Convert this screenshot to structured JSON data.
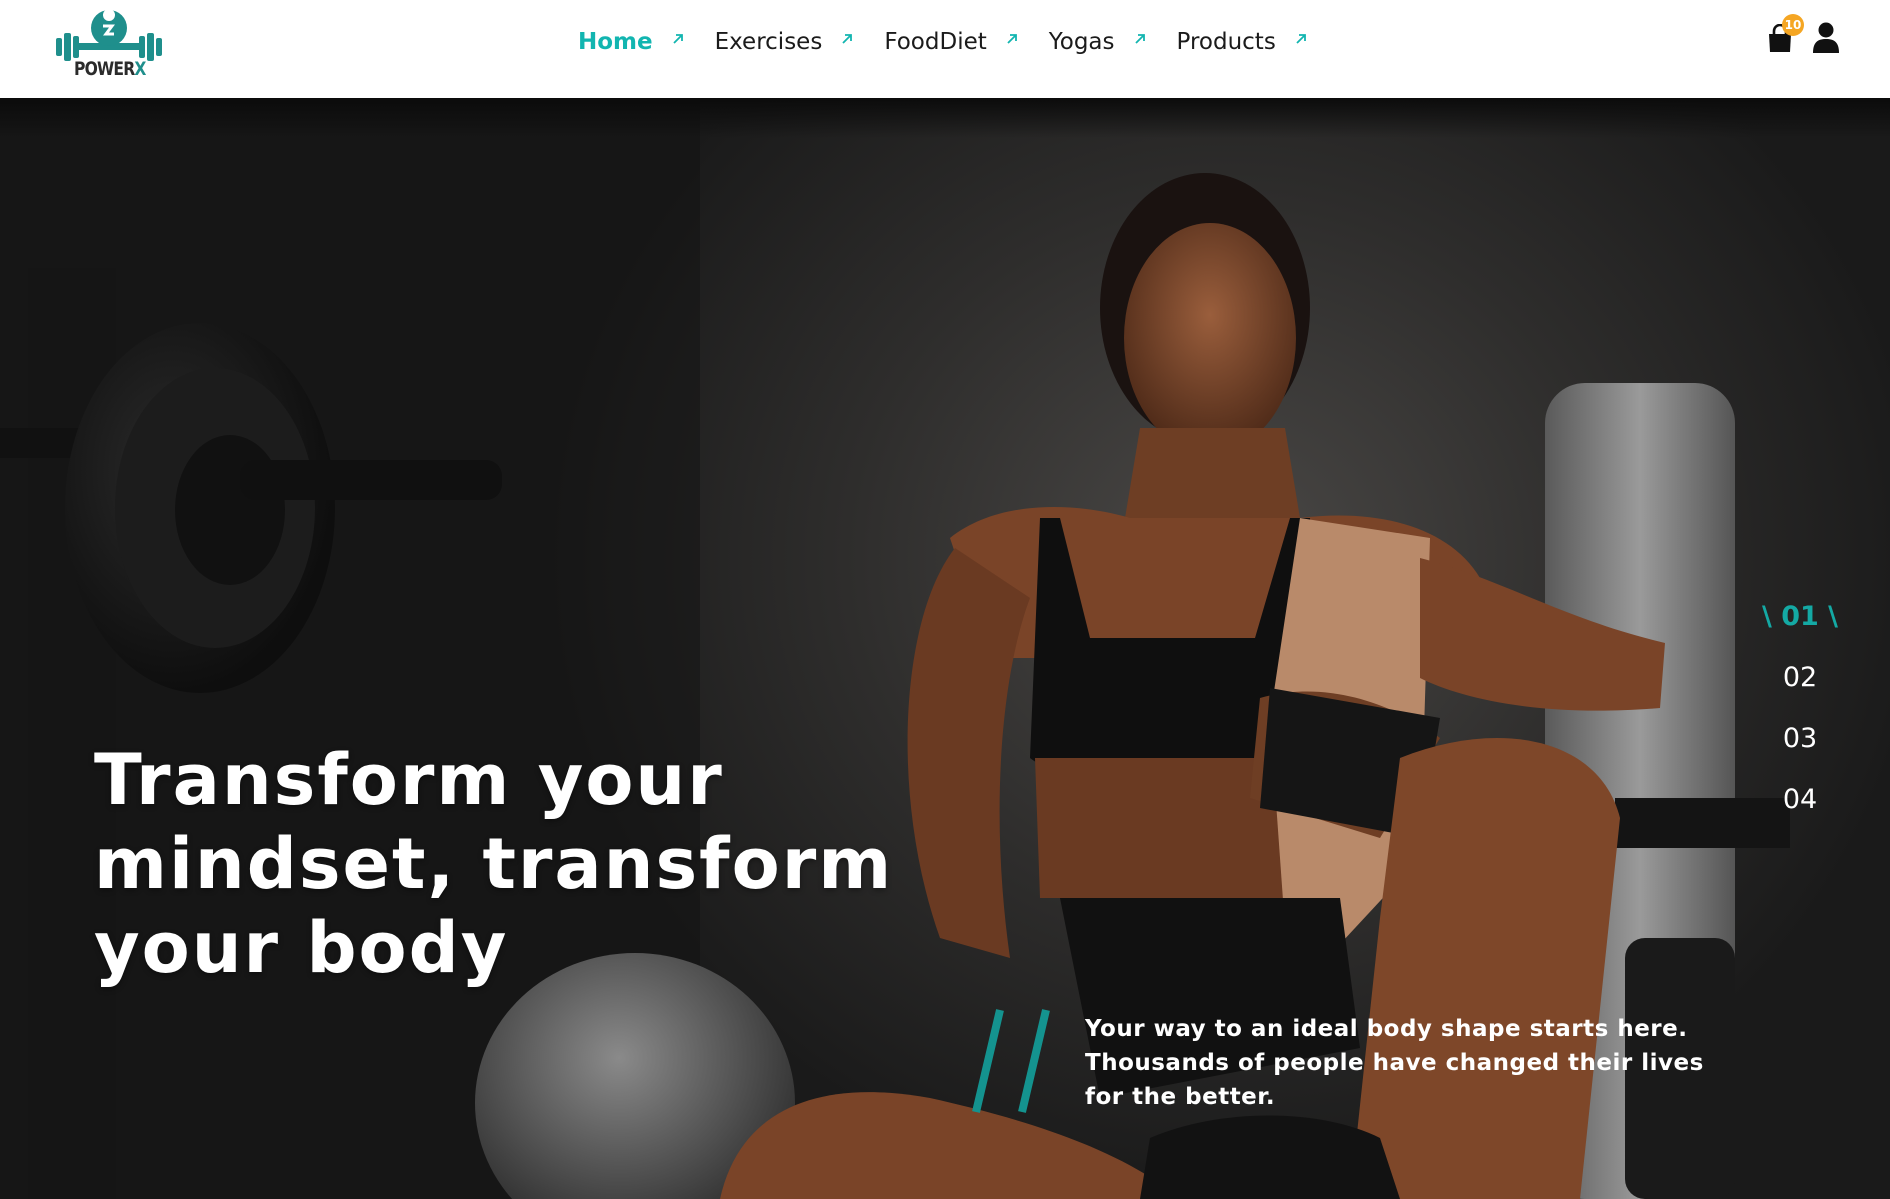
{
  "header": {
    "logo": {
      "brand_power": "POWER",
      "brand_x": "X"
    },
    "nav": [
      {
        "label": "Home",
        "active": true
      },
      {
        "label": "Exercises",
        "active": false
      },
      {
        "label": "FoodDiet",
        "active": false
      },
      {
        "label": "Yogas",
        "active": false
      },
      {
        "label": "Products",
        "active": false
      }
    ],
    "cart": {
      "count": "10",
      "icon": "shopping-bag-icon"
    },
    "user": {
      "icon": "user-icon"
    }
  },
  "hero": {
    "headline": "Transform your mindset, transform your body",
    "tagline": "Your way to an ideal body shape starts here. Thousands of people have changed their lives for the better.",
    "slides": {
      "active": "\\ 01 \\",
      "items": [
        "02",
        "03",
        "04"
      ]
    }
  },
  "colors": {
    "accent": "#12b5b0",
    "badge": "#f5a623",
    "hero_dark": "#1a1a1a",
    "slash": "#14938f"
  }
}
